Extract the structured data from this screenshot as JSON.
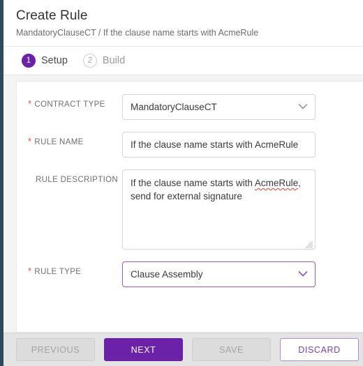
{
  "header": {
    "title": "Create Rule",
    "breadcrumb": "MandatoryClauseCT / If the clause name starts with AcmeRule"
  },
  "steps": [
    {
      "number": "1",
      "label": "Setup",
      "state": "active"
    },
    {
      "number": "2",
      "label": "Build",
      "state": "inactive"
    }
  ],
  "form": {
    "contract_type": {
      "label": "CONTRACT TYPE",
      "required": true,
      "value": "MandatoryClauseCT",
      "control": "select",
      "focused": false,
      "chevron_icon": "chevron-down-icon",
      "chevron_color": "#9a9a9a"
    },
    "rule_name": {
      "label": "RULE NAME",
      "required": true,
      "value": "If the clause name starts with AcmeRule",
      "placeholder": "",
      "control": "text"
    },
    "rule_description": {
      "label": "RULE DESCRIPTION",
      "required": false,
      "value": "If the clause name starts with AcmeRule, send for external signature",
      "value_parts": {
        "before": "If the clause name starts with ",
        "misspelled": "AcmeRule",
        "after": ", send for external signature"
      },
      "placeholder": "",
      "control": "textarea",
      "resize_handle_icon": "resize-grip-icon"
    },
    "rule_type": {
      "label": "RULE TYPE",
      "required": true,
      "value": "Clause Assembly",
      "control": "select",
      "focused": true,
      "chevron_icon": "chevron-down-icon",
      "chevron_color": "#8b5cb8"
    }
  },
  "footer": {
    "buttons": [
      {
        "label": "PREVIOUS",
        "style": "disabled",
        "enabled": false
      },
      {
        "label": "NEXT",
        "style": "primary",
        "enabled": true
      },
      {
        "label": "SAVE",
        "style": "disabled",
        "enabled": false
      },
      {
        "label": "DISCARD",
        "style": "outline",
        "enabled": true
      }
    ]
  },
  "colors": {
    "brand_purple": "#6b21a8",
    "outline_purple": "#b58ad4",
    "focus_purple": "#9b59c9",
    "required_red": "#f0503c",
    "spellcheck_red": "#e8362a",
    "left_rail": "#2c4a5a",
    "page_bg": "#f4f4f4",
    "footer_bg": "#e4e4e4"
  }
}
